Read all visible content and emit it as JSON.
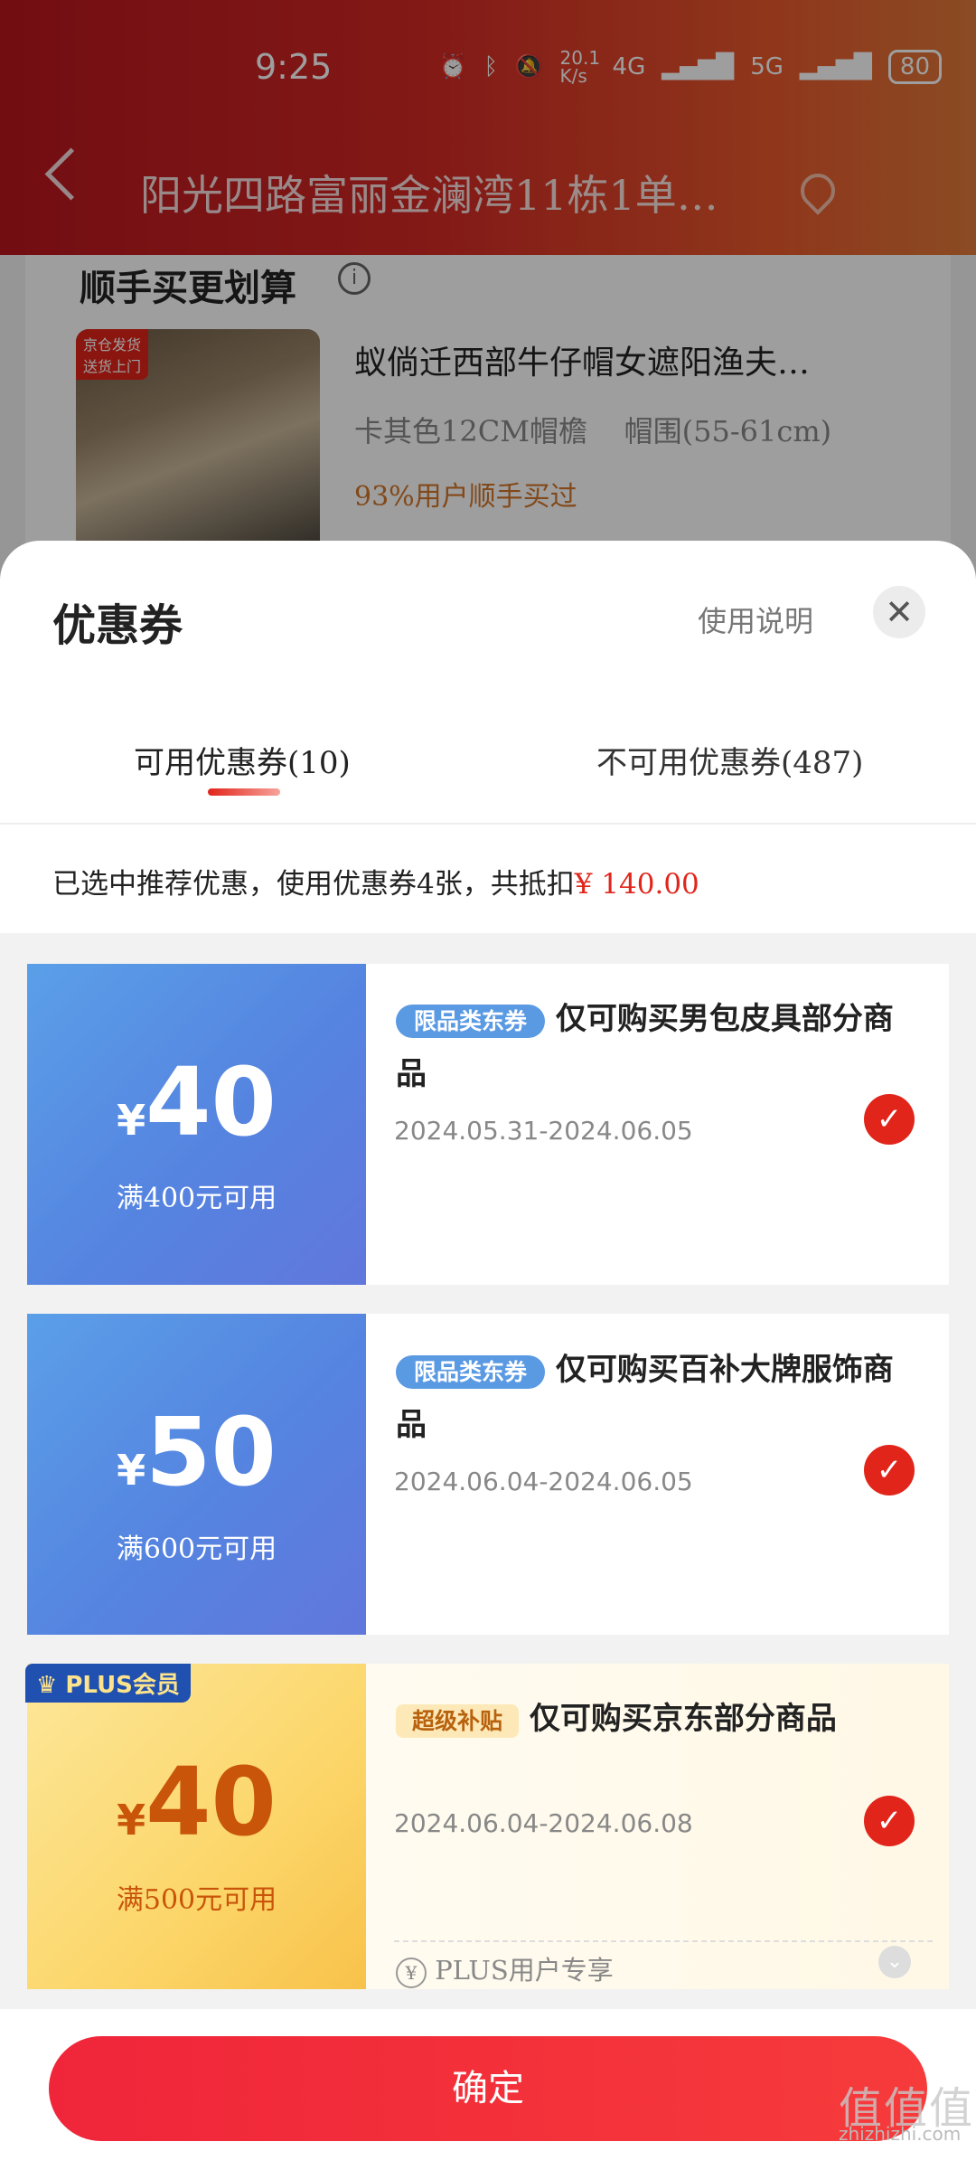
{
  "status": {
    "time": "9:25",
    "net_speed": "20.1 K/s",
    "signal1": "4G",
    "signal2": "5G",
    "battery": "80"
  },
  "header": {
    "address": "阳光四路富丽金澜湾11栋1单…"
  },
  "background_card": {
    "title": "顺手买更划算",
    "product_badge": "京仓发货 送货上门",
    "product_name": "蚁倘迁西部牛仔帽女遮阳渔夫…",
    "product_spec": "卡其色12CM帽檐    帽围(55-61cm)",
    "product_tag": "93%用户顺手买过"
  },
  "sheet": {
    "title": "优惠券",
    "help_label": "使用说明",
    "close_label": "✕",
    "tabs": [
      {
        "label": "可用优惠券(10)"
      },
      {
        "label": "不可用优惠券(487)"
      }
    ],
    "summary_text": "已选中推荐优惠，使用优惠券4张，共抵扣",
    "summary_amount": "¥ 140.00"
  },
  "coupons": [
    {
      "currency": "¥",
      "amount": "40",
      "condition": "满400元可用",
      "tag": "限品类东券",
      "title": "仅可购买男包皮具部分商品",
      "date": "2024.05.31-2024.06.05",
      "checked": true
    },
    {
      "currency": "¥",
      "amount": "50",
      "condition": "满600元可用",
      "tag": "限品类东券",
      "title": "仅可购买百补大牌服饰商品",
      "date": "2024.06.04-2024.06.05",
      "checked": true
    },
    {
      "currency": "¥",
      "amount": "40",
      "condition": "满500元可用",
      "tag": "超级补贴",
      "title": "仅可购买京东部分商品",
      "date": "2024.06.04-2024.06.08",
      "checked": true,
      "badge": "PLUS会员",
      "note": "PLUS用户专享",
      "note_icon": "¥"
    }
  ],
  "footer": {
    "confirm_label": "确定"
  },
  "watermark": {
    "logo": "值值值",
    "site": "zhizhizhi.com"
  },
  "colors": {
    "accent": "#e1251b",
    "coupon_blue": "#5584e0",
    "coupon_gold": "#fcd66a"
  }
}
